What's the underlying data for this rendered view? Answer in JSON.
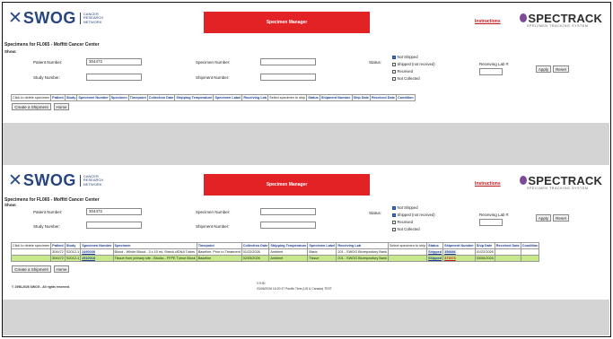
{
  "header": {
    "logo_word": "SWOG",
    "logo_sub_1": "CANCER",
    "logo_sub_2": "RESEARCH",
    "logo_sub_3": "NETWORK",
    "banner_title": "Specimen Manager",
    "instructions_label": "Instructions",
    "spectrack_word": "SPECTRACK",
    "spectrack_sub": "SPECIMEN TRACKING SYSTEM"
  },
  "page_title": "Specimens for FL065 - Moffitt Cancer Center",
  "show_label": "Show:",
  "form": {
    "patient_number_label": "Patient Number:",
    "patient_number_value": "304472",
    "study_number_label": "Study Number:",
    "specimen_number_label": "Specimen Number:",
    "shipment_number_label": "Shipment Number:",
    "status_label": "Status:",
    "status_options": [
      "Not Shipped",
      "Shipped (not received)",
      "Received",
      "Not Collected"
    ],
    "receiving_lab_label": "Receiving Lab #:",
    "apply_label": "Apply",
    "reset_label": "Reset"
  },
  "panel1_columns": [
    "Click to delete specimen",
    "Patient",
    "Study",
    "Specimen Number",
    "Specimen",
    "Timepoint",
    "Collection Date",
    "Shipping Temperature",
    "Specimen Label",
    "Receiving Lab",
    "Select specimen to ship",
    "Status",
    "Shipment Number",
    "Ship Date",
    "Received Date",
    "Condition"
  ],
  "buttons": {
    "create_shipment": "Create a Shipment",
    "home": "Home"
  },
  "panel2_columns": [
    "Click to delete specimen",
    "Patient",
    "Study",
    "Specimen Number",
    "Specimen",
    "Timepoint",
    "Collection Date",
    "Shipping Temperature",
    "Specimen Label",
    "Receiving Lab",
    "Select specimen to ship",
    "Status",
    "Shipment Number",
    "Ship Date",
    "Received Date",
    "Condition"
  ],
  "rows": [
    {
      "patient": "304472",
      "study": "S2012-1",
      "specimen_number": "2490039",
      "specimen": "Blood - Whole Blood - 3 x 10 mL Streck cfDNA Tubes",
      "timepoint": "Baseline, Prior to Treatment",
      "collection_date": "01/22/2026",
      "shipping_temperature": "Ambient",
      "specimen_label": "Basic",
      "receiving_lab": "201 - SWOG Biorepository Bank",
      "status": "Shipped",
      "shipment_number": "359886",
      "ship_date": "01/22/2026",
      "received_date": "",
      "condition": ""
    },
    {
      "patient": "304472",
      "study": "S2012-1",
      "specimen_number": "2510018",
      "specimen": "Tissue from primary site - Blocks - FFPE Tumor Block",
      "timepoint": "Baseline",
      "collection_date": "02/05/2026",
      "shipping_temperature": "Ambient",
      "specimen_label": "Tissue",
      "receiving_lab": "201 - SWOG Biorepository Bank",
      "status": "Shipped",
      "shipment_number": "371573",
      "ship_date": "03/06/2026",
      "received_date": "",
      "condition": ""
    }
  ],
  "footer": {
    "copyright": "© 1998-2026 SWOG - All rights reserved.",
    "version": "3.9.90",
    "timestamp": "03/06/2026 16:20:37 Pacific Time (US & Canada) TEST"
  },
  "colors": {
    "brand_blue": "#27457f",
    "banner_red": "#e32225",
    "highlight_row": "#c7e88a",
    "link_blue": "#1b3f92"
  }
}
